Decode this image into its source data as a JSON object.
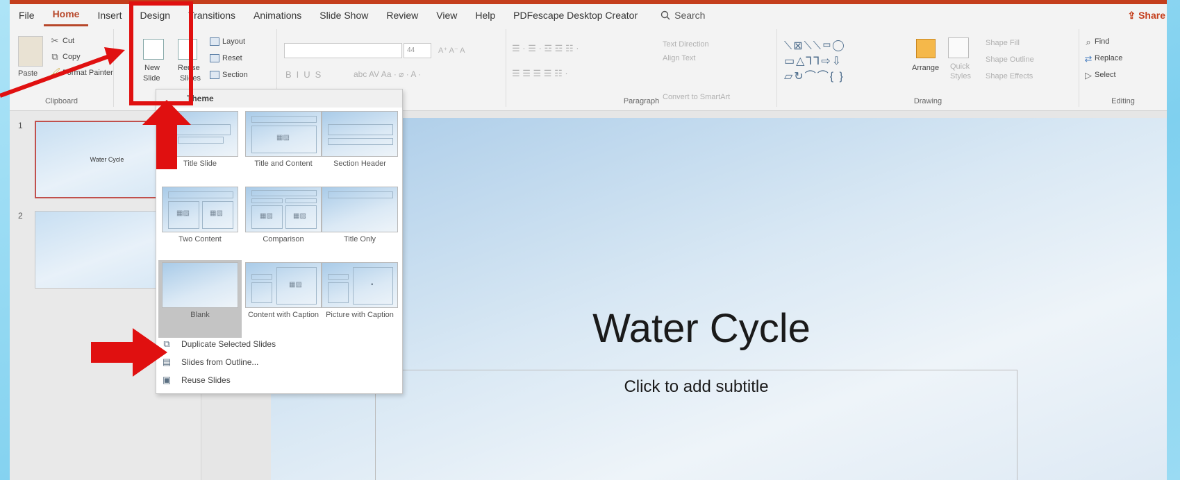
{
  "menu": {
    "items": [
      "File",
      "Home",
      "Insert",
      "Design",
      "Transitions",
      "Animations",
      "Slide Show",
      "Review",
      "View",
      "Help",
      "PDFescape Desktop Creator"
    ],
    "active": "Home",
    "search_label": "Search",
    "share_label": "Share"
  },
  "clipboard": {
    "cut": "Cut",
    "copy": "Copy",
    "format_painter": "Format Painter",
    "paste": "Paste",
    "label": "Clipboard"
  },
  "slides_group": {
    "new_slide": "New",
    "new_slide_2": "Slide",
    "reuse": "Reuse",
    "reuse_2": "Slides",
    "layout": "Layout",
    "reset": "Reset",
    "section": "Section"
  },
  "font": {
    "size": "44"
  },
  "paragraph": {
    "text_direction": "Text Direction",
    "align_text": "Align Text",
    "smartart": "Convert to SmartArt",
    "label": "Paragraph"
  },
  "drawing": {
    "arrange": "Arrange",
    "quick_styles": "Quick",
    "quick_styles_2": "Styles",
    "shape_fill": "Shape Fill",
    "shape_outline": "Shape Outline",
    "shape_effects": "Shape Effects",
    "label": "Drawing"
  },
  "editing": {
    "find": "Find",
    "replace": "Replace",
    "select": "Select",
    "label": "Editing"
  },
  "dropdown": {
    "header": "Theme",
    "layouts": [
      {
        "name": "Title Slide"
      },
      {
        "name": "Title and Content"
      },
      {
        "name": "Section Header"
      },
      {
        "name": "Two Content"
      },
      {
        "name": "Comparison"
      },
      {
        "name": "Title Only"
      },
      {
        "name": "Blank"
      },
      {
        "name": "Content with Caption"
      },
      {
        "name": "Picture with Caption"
      }
    ],
    "menu_items": [
      "Duplicate Selected Slides",
      "Slides from Outline...",
      "Reuse Slides"
    ]
  },
  "thumbnails": [
    {
      "number": "1",
      "title": "Water Cycle"
    },
    {
      "number": "2",
      "title": ""
    }
  ],
  "slide": {
    "title": "Water Cycle",
    "subtitle": "Click to add subtitle"
  },
  "colors": {
    "accent": "#b7472a",
    "annotation_red": "#e01010"
  }
}
